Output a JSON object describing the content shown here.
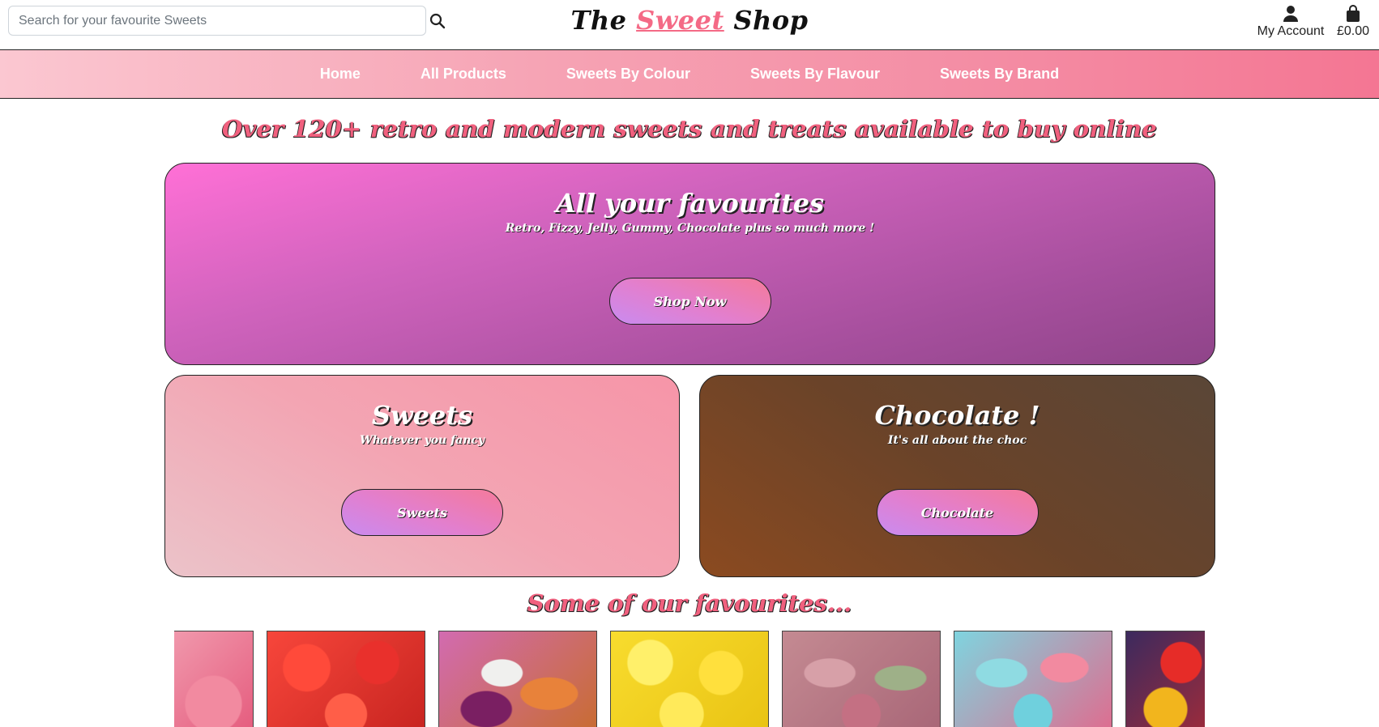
{
  "header": {
    "search_placeholder": "Search for your favourite Sweets",
    "search_icon": "search-icon",
    "logo": {
      "part1": "The ",
      "accent": "Sweet",
      "part2": " Shop"
    },
    "account_label": "My Account",
    "account_icon": "user-icon",
    "bag_total": "£0.00",
    "bag_icon": "shopping-bag-icon"
  },
  "nav": {
    "items": [
      "Home",
      "All Products",
      "Sweets By Colour",
      "Sweets By Flavour",
      "Sweets By Brand"
    ]
  },
  "headline": "Over 120+ retro and modern sweets and treats available to buy online",
  "hero": {
    "title": "All your favourites",
    "subtitle": "Retro, Fizzy, Jelly, Gummy, Chocolate plus so much more !",
    "button": "Shop Now"
  },
  "sweets_panel": {
    "title": "Sweets",
    "subtitle": "Whatever you fancy",
    "button": "Sweets"
  },
  "choc_panel": {
    "title": "Chocolate !",
    "subtitle": "It's all about the choc",
    "button": "Chocolate"
  },
  "favourites": {
    "title": "Some of our favourites..."
  },
  "colors": {
    "accent_pink": "#f0607e",
    "hero_purple": "#a64f9d",
    "choc_brown": "#6a4329"
  }
}
